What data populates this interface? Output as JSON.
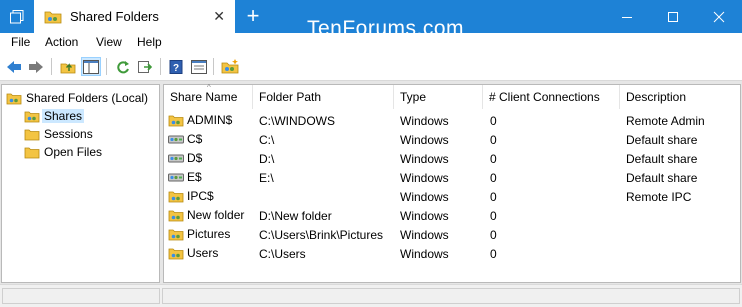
{
  "window": {
    "tab_title": "Shared Folders",
    "watermark": "TenForums.com",
    "controls": [
      "minimize-button",
      "maximize-button",
      "close-button"
    ]
  },
  "menu": [
    "File",
    "Action",
    "View",
    "Help"
  ],
  "toolbar": [
    "back-icon",
    "forward-icon",
    "up-folder-icon",
    "show-hide-tree-icon",
    "refresh-icon",
    "export-list-icon",
    "help-icon",
    "properties-icon",
    "new-share-icon"
  ],
  "tree": {
    "root": "Shared Folders (Local)",
    "items": [
      "Shares",
      "Sessions",
      "Open Files"
    ],
    "selected": "Shares"
  },
  "list": {
    "columns": [
      "Share Name",
      "Folder Path",
      "Type",
      "# Client Connections",
      "Description"
    ],
    "rows": [
      {
        "name": "ADMIN$",
        "path": "C:\\WINDOWS",
        "type": "Windows",
        "connections": "0",
        "description": "Remote Admin",
        "icon": "admin-share-icon"
      },
      {
        "name": "C$",
        "path": "C:\\",
        "type": "Windows",
        "connections": "0",
        "description": "Default share",
        "icon": "drive-share-icon"
      },
      {
        "name": "D$",
        "path": "D:\\",
        "type": "Windows",
        "connections": "0",
        "description": "Default share",
        "icon": "drive-share-icon"
      },
      {
        "name": "E$",
        "path": "E:\\",
        "type": "Windows",
        "connections": "0",
        "description": "Default share",
        "icon": "drive-share-icon"
      },
      {
        "name": "IPC$",
        "path": "",
        "type": "Windows",
        "connections": "0",
        "description": "Remote IPC",
        "icon": "ipc-share-icon"
      },
      {
        "name": "New folder",
        "path": "D:\\New folder",
        "type": "Windows",
        "connections": "0",
        "description": "",
        "icon": "folder-share-icon"
      },
      {
        "name": "Pictures",
        "path": "C:\\Users\\Brink\\Pictures",
        "type": "Windows",
        "connections": "0",
        "description": "",
        "icon": "folder-share-icon"
      },
      {
        "name": "Users",
        "path": "C:\\Users",
        "type": "Windows",
        "connections": "0",
        "description": "",
        "icon": "folder-share-icon"
      }
    ]
  },
  "colors": {
    "accent": "#1e82d6",
    "selection": "#cce8ff",
    "folder": "#f3c443"
  }
}
